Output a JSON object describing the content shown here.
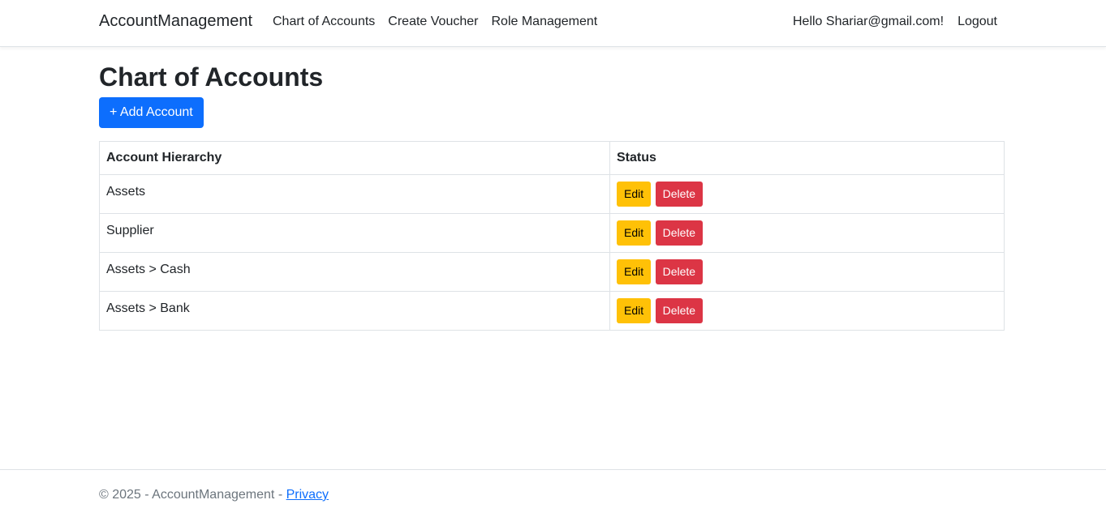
{
  "nav": {
    "brand": "AccountManagement",
    "links": [
      "Chart of Accounts",
      "Create Voucher",
      "Role Management"
    ],
    "greeting": "Hello Shariar@gmail.com!",
    "logout": "Logout"
  },
  "main": {
    "title": "Chart of Accounts",
    "add_button": "+ Add Account",
    "table": {
      "headers": [
        "Account Hierarchy",
        "Status"
      ],
      "rows": [
        {
          "name": "Assets",
          "edit": "Edit",
          "delete": "Delete"
        },
        {
          "name": "Supplier",
          "edit": "Edit",
          "delete": "Delete"
        },
        {
          "name": "Assets > Cash",
          "edit": "Edit",
          "delete": "Delete"
        },
        {
          "name": "Assets > Bank",
          "edit": "Edit",
          "delete": "Delete"
        }
      ]
    }
  },
  "footer": {
    "text": "© 2025 - AccountManagement - ",
    "privacy": "Privacy"
  },
  "colors": {
    "primary": "#0d6efd",
    "warning": "#ffc107",
    "danger": "#dc3545"
  }
}
